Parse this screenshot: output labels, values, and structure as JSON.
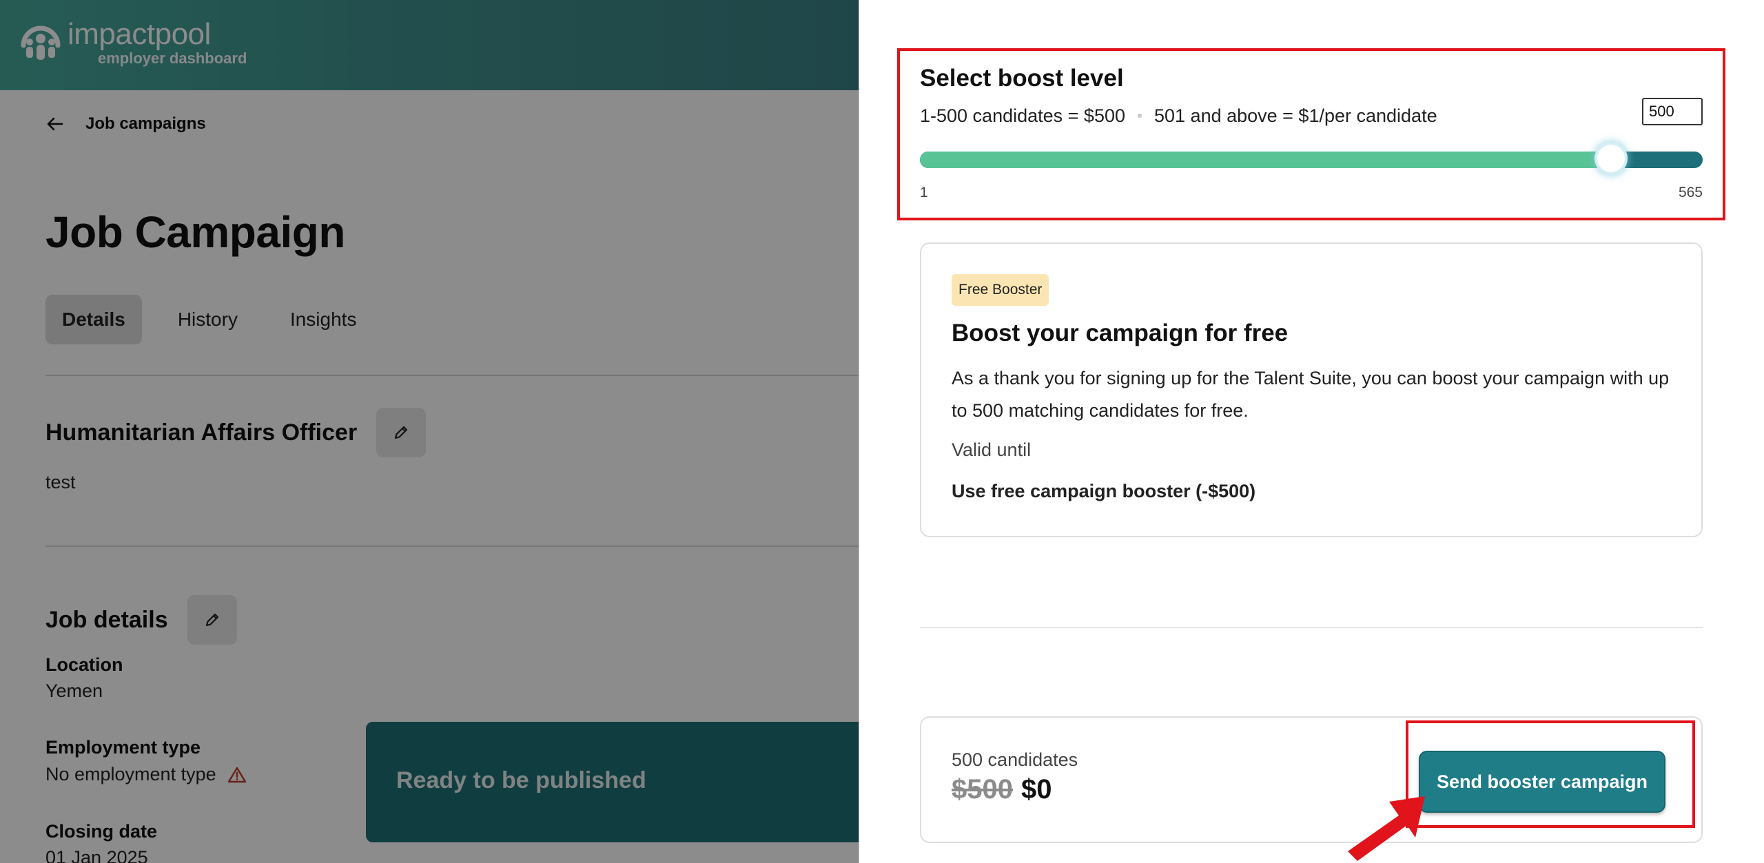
{
  "header": {
    "logo_word": "impactpool",
    "logo_sub": "employer dashboard"
  },
  "nav": {
    "back_label": "Job campaigns"
  },
  "page": {
    "title": "Job Campaign",
    "tabs": [
      {
        "label": "Details",
        "active": true
      },
      {
        "label": "History",
        "active": false
      },
      {
        "label": "Insights",
        "active": false
      }
    ]
  },
  "job": {
    "name": "Humanitarian Affairs Officer",
    "description": "test",
    "details_title": "Job details",
    "location_label": "Location",
    "location_value": "Yemen",
    "employment_label": "Employment type",
    "employment_value": "No employment type",
    "closing_label": "Closing date",
    "closing_value": "01 Jan 2025"
  },
  "publish_bar": {
    "text": "Ready to be published"
  },
  "boost": {
    "title": "Select boost level",
    "price_tier_1": "1-500 candidates = $500",
    "price_tier_2": "501 and above = $1/per candidate",
    "input_value": "500",
    "slider_min": "1",
    "slider_max": "565",
    "slider_fraction": 0.883
  },
  "free_card": {
    "badge": "Free Booster",
    "title": "Boost your campaign for free",
    "description": "As a thank you for signing up for the Talent Suite, you can boost your campaign with up to 500 matching candidates for free.",
    "valid_label": "Valid until",
    "use_label": "Use free campaign booster (-$500)"
  },
  "summary": {
    "count": "500 candidates",
    "old_price": "$500",
    "new_price": "$0",
    "send_label": "Send booster campaign"
  },
  "colors": {
    "brand_teal": "#1f7d88",
    "slider_fill": "#58c496",
    "slider_track": "#1d6f7a",
    "highlight_red": "#e2141b",
    "badge_bg": "#fbe6b3"
  },
  "icons": {
    "back": "arrow-left-icon",
    "edit": "pencil-icon",
    "warning": "warning-triangle-icon",
    "annotation": "red-pointer-arrow-icon"
  }
}
